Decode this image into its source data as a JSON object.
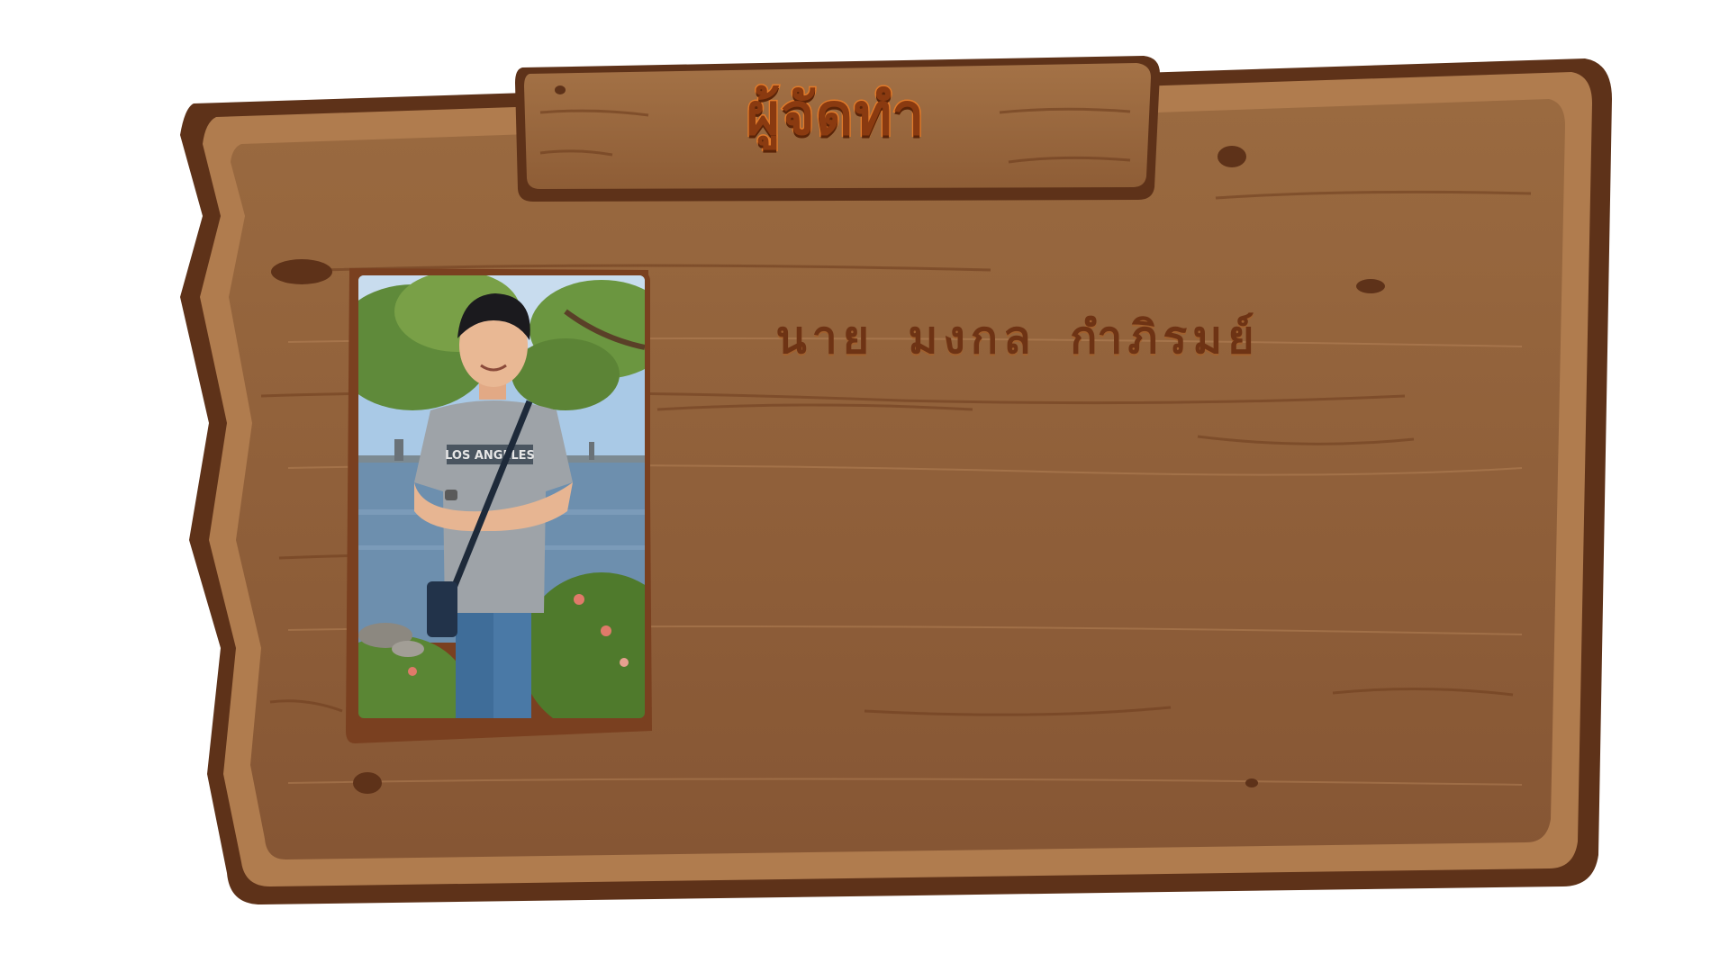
{
  "sign": {
    "title": "ผู้จัดทำ",
    "name": "นาย  มงกล  กำภิรมย์"
  },
  "photo": {
    "shirt_text": "LOS ANGELES"
  },
  "colors": {
    "wood_main": "#8a5a34",
    "wood_dark": "#5e3219",
    "wood_edge": "#b07c4e",
    "title_fill": "#8a3a10",
    "title_stroke": "#e07a2a",
    "name_color": "#6e3314"
  }
}
